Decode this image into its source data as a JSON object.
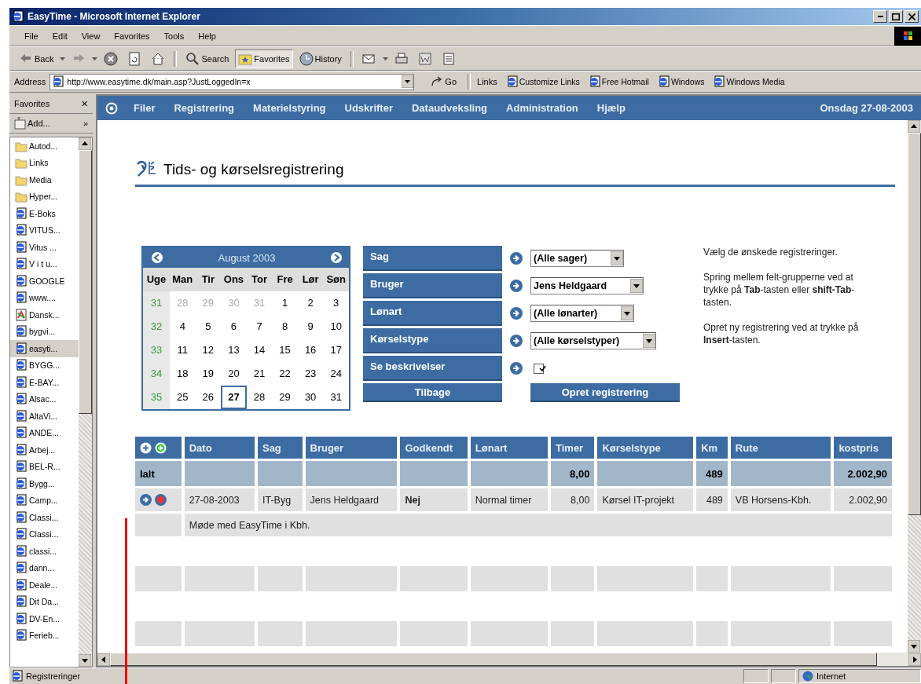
{
  "window": {
    "title": "EasyTime - Microsoft Internet Explorer"
  },
  "menu": [
    "File",
    "Edit",
    "View",
    "Favorites",
    "Tools",
    "Help"
  ],
  "toolbar": [
    {
      "kind": "back",
      "label": "Back"
    },
    {
      "kind": "forward"
    },
    {
      "kind": "stop"
    },
    {
      "kind": "refresh"
    },
    {
      "kind": "home"
    },
    {
      "kind": "search",
      "label": "Search"
    },
    {
      "kind": "favorites",
      "label": "Favorites",
      "selected": true
    },
    {
      "kind": "history",
      "label": "History",
      "selected": false
    },
    {
      "kind": "mail"
    },
    {
      "kind": "print"
    },
    {
      "kind": "edit"
    },
    {
      "kind": "discuss"
    }
  ],
  "address": {
    "label": "Address",
    "value": "http://www.easytime.dk/main.asp?JustLoggedIn=x",
    "go": "Go",
    "links_label": "Links",
    "links": [
      "Customize Links",
      "Free Hotmail",
      "Windows",
      "Windows Media"
    ]
  },
  "favorites": {
    "title": "Favorites",
    "close": "✕",
    "add": "Add...",
    "more": "»",
    "items": [
      {
        "kind": "folder",
        "label": "Autod...",
        "selected": false
      },
      {
        "kind": "folder",
        "label": "Links",
        "selected": false
      },
      {
        "kind": "folder",
        "label": "Media",
        "selected": false
      },
      {
        "kind": "folder",
        "label": "Hyper...",
        "selected": false
      },
      {
        "kind": "page",
        "label": "E-Boks",
        "selected": false
      },
      {
        "kind": "page",
        "label": "VITUS...",
        "selected": false
      },
      {
        "kind": "page",
        "label": "Vitus ...",
        "selected": false
      },
      {
        "kind": "page",
        "label": "V i t u...",
        "selected": false
      },
      {
        "kind": "page",
        "label": "GOOGLE",
        "selected": false
      },
      {
        "kind": "page",
        "label": "www....",
        "selected": false
      },
      {
        "kind": "app",
        "label": "Dansk...",
        "selected": false
      },
      {
        "kind": "page",
        "label": "bygvi...",
        "selected": false
      },
      {
        "kind": "page",
        "label": "easyti...",
        "selected": true
      },
      {
        "kind": "page",
        "label": "BYGG...",
        "selected": false
      },
      {
        "kind": "page",
        "label": "E-BAY...",
        "selected": false
      },
      {
        "kind": "page",
        "label": "Alsac...",
        "selected": false
      },
      {
        "kind": "page",
        "label": "AltaVi...",
        "selected": false
      },
      {
        "kind": "page",
        "label": "ANDE...",
        "selected": false
      },
      {
        "kind": "page",
        "label": "Arbej...",
        "selected": false
      },
      {
        "kind": "page",
        "label": "BEL-R...",
        "selected": false
      },
      {
        "kind": "page",
        "label": "Bygg...",
        "selected": false
      },
      {
        "kind": "page",
        "label": "Camp...",
        "selected": false
      },
      {
        "kind": "page",
        "label": "Classi...",
        "selected": false
      },
      {
        "kind": "page",
        "label": "Classi...",
        "selected": false
      },
      {
        "kind": "page",
        "label": "classi...",
        "selected": false
      },
      {
        "kind": "page",
        "label": "dann...",
        "selected": false
      },
      {
        "kind": "page",
        "label": "Deale...",
        "selected": false
      },
      {
        "kind": "page",
        "label": "Dit Da...",
        "selected": false
      },
      {
        "kind": "page",
        "label": "DV-En...",
        "selected": false
      },
      {
        "kind": "page",
        "label": "Ferieb...",
        "selected": false
      }
    ]
  },
  "nav": {
    "items": [
      "Filer",
      "Registrering",
      "Materielstyring",
      "Udskrifter",
      "Dataudveksling",
      "Administration",
      "Hjælp"
    ],
    "date": "Onsdag 27-08-2003"
  },
  "page_title": "Tids- og kørselsregistrering",
  "calendar": {
    "month": "August 2003",
    "headers": [
      "Uge",
      "Man",
      "Tir",
      "Ons",
      "Tor",
      "Fre",
      "Lør",
      "Søn"
    ],
    "weeks": [
      {
        "week": "31",
        "days": [
          {
            "day": "28",
            "other_month": true,
            "selected": false
          },
          {
            "day": "29",
            "other_month": true,
            "selected": false
          },
          {
            "day": "30",
            "other_month": true,
            "selected": false
          },
          {
            "day": "31",
            "other_month": true,
            "selected": false
          },
          {
            "day": "1",
            "other_month": false,
            "selected": false
          },
          {
            "day": "2",
            "other_month": false,
            "selected": false
          },
          {
            "day": "3",
            "other_month": false,
            "selected": false
          }
        ]
      },
      {
        "week": "32",
        "days": [
          {
            "day": "4",
            "other_month": false,
            "selected": false
          },
          {
            "day": "5",
            "other_month": false,
            "selected": false
          },
          {
            "day": "6",
            "other_month": false,
            "selected": false
          },
          {
            "day": "7",
            "other_month": false,
            "selected": false
          },
          {
            "day": "8",
            "other_month": false,
            "selected": false
          },
          {
            "day": "9",
            "other_month": false,
            "selected": false
          },
          {
            "day": "10",
            "other_month": false,
            "selected": false
          }
        ]
      },
      {
        "week": "33",
        "days": [
          {
            "day": "11",
            "other_month": false,
            "selected": false
          },
          {
            "day": "12",
            "other_month": false,
            "selected": false
          },
          {
            "day": "13",
            "other_month": false,
            "selected": false
          },
          {
            "day": "14",
            "other_month": false,
            "selected": false
          },
          {
            "day": "15",
            "other_month": false,
            "selected": false
          },
          {
            "day": "16",
            "other_month": false,
            "selected": false
          },
          {
            "day": "17",
            "other_month": false,
            "selected": false
          }
        ]
      },
      {
        "week": "34",
        "days": [
          {
            "day": "18",
            "other_month": false,
            "selected": false
          },
          {
            "day": "19",
            "other_month": false,
            "selected": false
          },
          {
            "day": "20",
            "other_month": false,
            "selected": false
          },
          {
            "day": "21",
            "other_month": false,
            "selected": false
          },
          {
            "day": "22",
            "other_month": false,
            "selected": false
          },
          {
            "day": "23",
            "other_month": false,
            "selected": false
          },
          {
            "day": "24",
            "other_month": false,
            "selected": false
          }
        ]
      },
      {
        "week": "35",
        "days": [
          {
            "day": "25",
            "other_month": false,
            "selected": false
          },
          {
            "day": "26",
            "other_month": false,
            "selected": false
          },
          {
            "day": "27",
            "other_month": false,
            "selected": true
          },
          {
            "day": "28",
            "other_month": false,
            "selected": false
          },
          {
            "day": "29",
            "other_month": false,
            "selected": false
          },
          {
            "day": "30",
            "other_month": false,
            "selected": false
          },
          {
            "day": "31",
            "other_month": false,
            "selected": false
          }
        ]
      }
    ]
  },
  "filters": [
    {
      "label": "Sag",
      "kind": "select",
      "value": "(Alle sager)"
    },
    {
      "label": "Bruger",
      "kind": "select",
      "value": "Jens Heldgaard"
    },
    {
      "label": "Lønart",
      "kind": "select",
      "value": "(Alle lønarter)"
    },
    {
      "label": "Kørselstype",
      "kind": "select",
      "value": "(Alle kørselstyper)"
    },
    {
      "label": "Se beskrivelser",
      "kind": "checkbox",
      "checked": true
    }
  ],
  "buttons": {
    "back": "Tilbage",
    "create": "Opret registrering"
  },
  "help": [
    "Vælg de ønskede registreringer.",
    "Spring mellem felt-grupperne ved at trykke på **Tab**-tasten eller **shift-Tab**-tasten.",
    "Opret ny registrering ved at trykke på **Insert**-tasten."
  ],
  "table": {
    "columns": [
      "Dato",
      "Sag",
      "Bruger",
      "Godkendt",
      "Lønart",
      "Timer",
      "Kørselstype",
      "Km",
      "Rute",
      "kostpris"
    ],
    "total": {
      "label": "Ialt",
      "cells": [
        "",
        "",
        "",
        "",
        "",
        "8,00",
        "",
        "489",
        "",
        "2.002,90"
      ]
    },
    "rows": [
      {
        "cells": [
          "27-08-2003",
          "IT-Byg",
          "Jens Heldgaard",
          "Nej",
          "Normal timer",
          "8,00",
          "Kørsel IT-projekt",
          "489",
          "VB Horsens-Kbh.",
          "2.002,90"
        ],
        "description": "Møde med EasyTime i Kbh."
      }
    ],
    "filler_rows": [
      {
        "shaded": false
      },
      {
        "shaded": true
      },
      {
        "shaded": false
      },
      {
        "shaded": true
      }
    ]
  },
  "status_bar": {
    "text": "Registreringer",
    "zone": "Internet"
  }
}
